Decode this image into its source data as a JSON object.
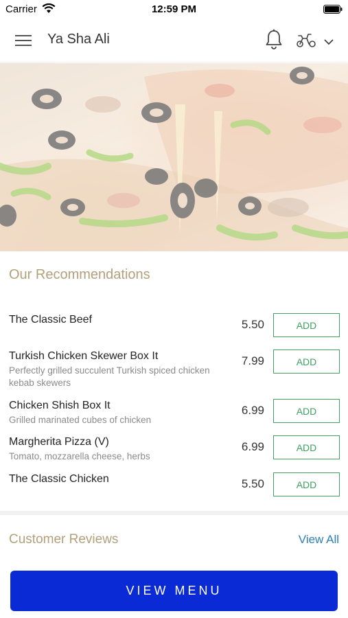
{
  "status_bar": {
    "carrier": "Carrier",
    "time": "12:59 PM"
  },
  "header": {
    "title": "Ya Sha Ali",
    "icons": [
      "menu-icon",
      "bell-icon",
      "scooter-icon",
      "chevron-down-icon"
    ]
  },
  "hero": {
    "image_description_icon": "pizza-photo"
  },
  "recommendations": {
    "title": "Our Recommendations",
    "items": [
      {
        "name": "The Classic Beef",
        "description": "",
        "price": "5.50",
        "add_label": "ADD"
      },
      {
        "name": "Turkish Chicken Skewer Box It",
        "description": "Perfectly grilled succulent Turkish spiced chicken kebab skewers",
        "price": "7.99",
        "add_label": "ADD"
      },
      {
        "name": "Chicken Shish Box It",
        "description": "Grilled marinated cubes of chicken",
        "price": "6.99",
        "add_label": "ADD"
      },
      {
        "name": "Margherita Pizza (V)",
        "description": "Tomato, mozzarella cheese, herbs",
        "price": "6.99",
        "add_label": "ADD"
      },
      {
        "name": "The Classic Chicken",
        "description": "",
        "price": "5.50",
        "add_label": "ADD"
      }
    ]
  },
  "reviews": {
    "title": "Customer Reviews",
    "view_all_label": "View All"
  },
  "footer": {
    "view_menu_label": "VIEW MENU"
  },
  "colors": {
    "accent_green": "#3fa060",
    "primary_blue": "#0a2ad6",
    "section_title_gold": "#b3a07a",
    "link_blue": "#2a7fb8"
  }
}
